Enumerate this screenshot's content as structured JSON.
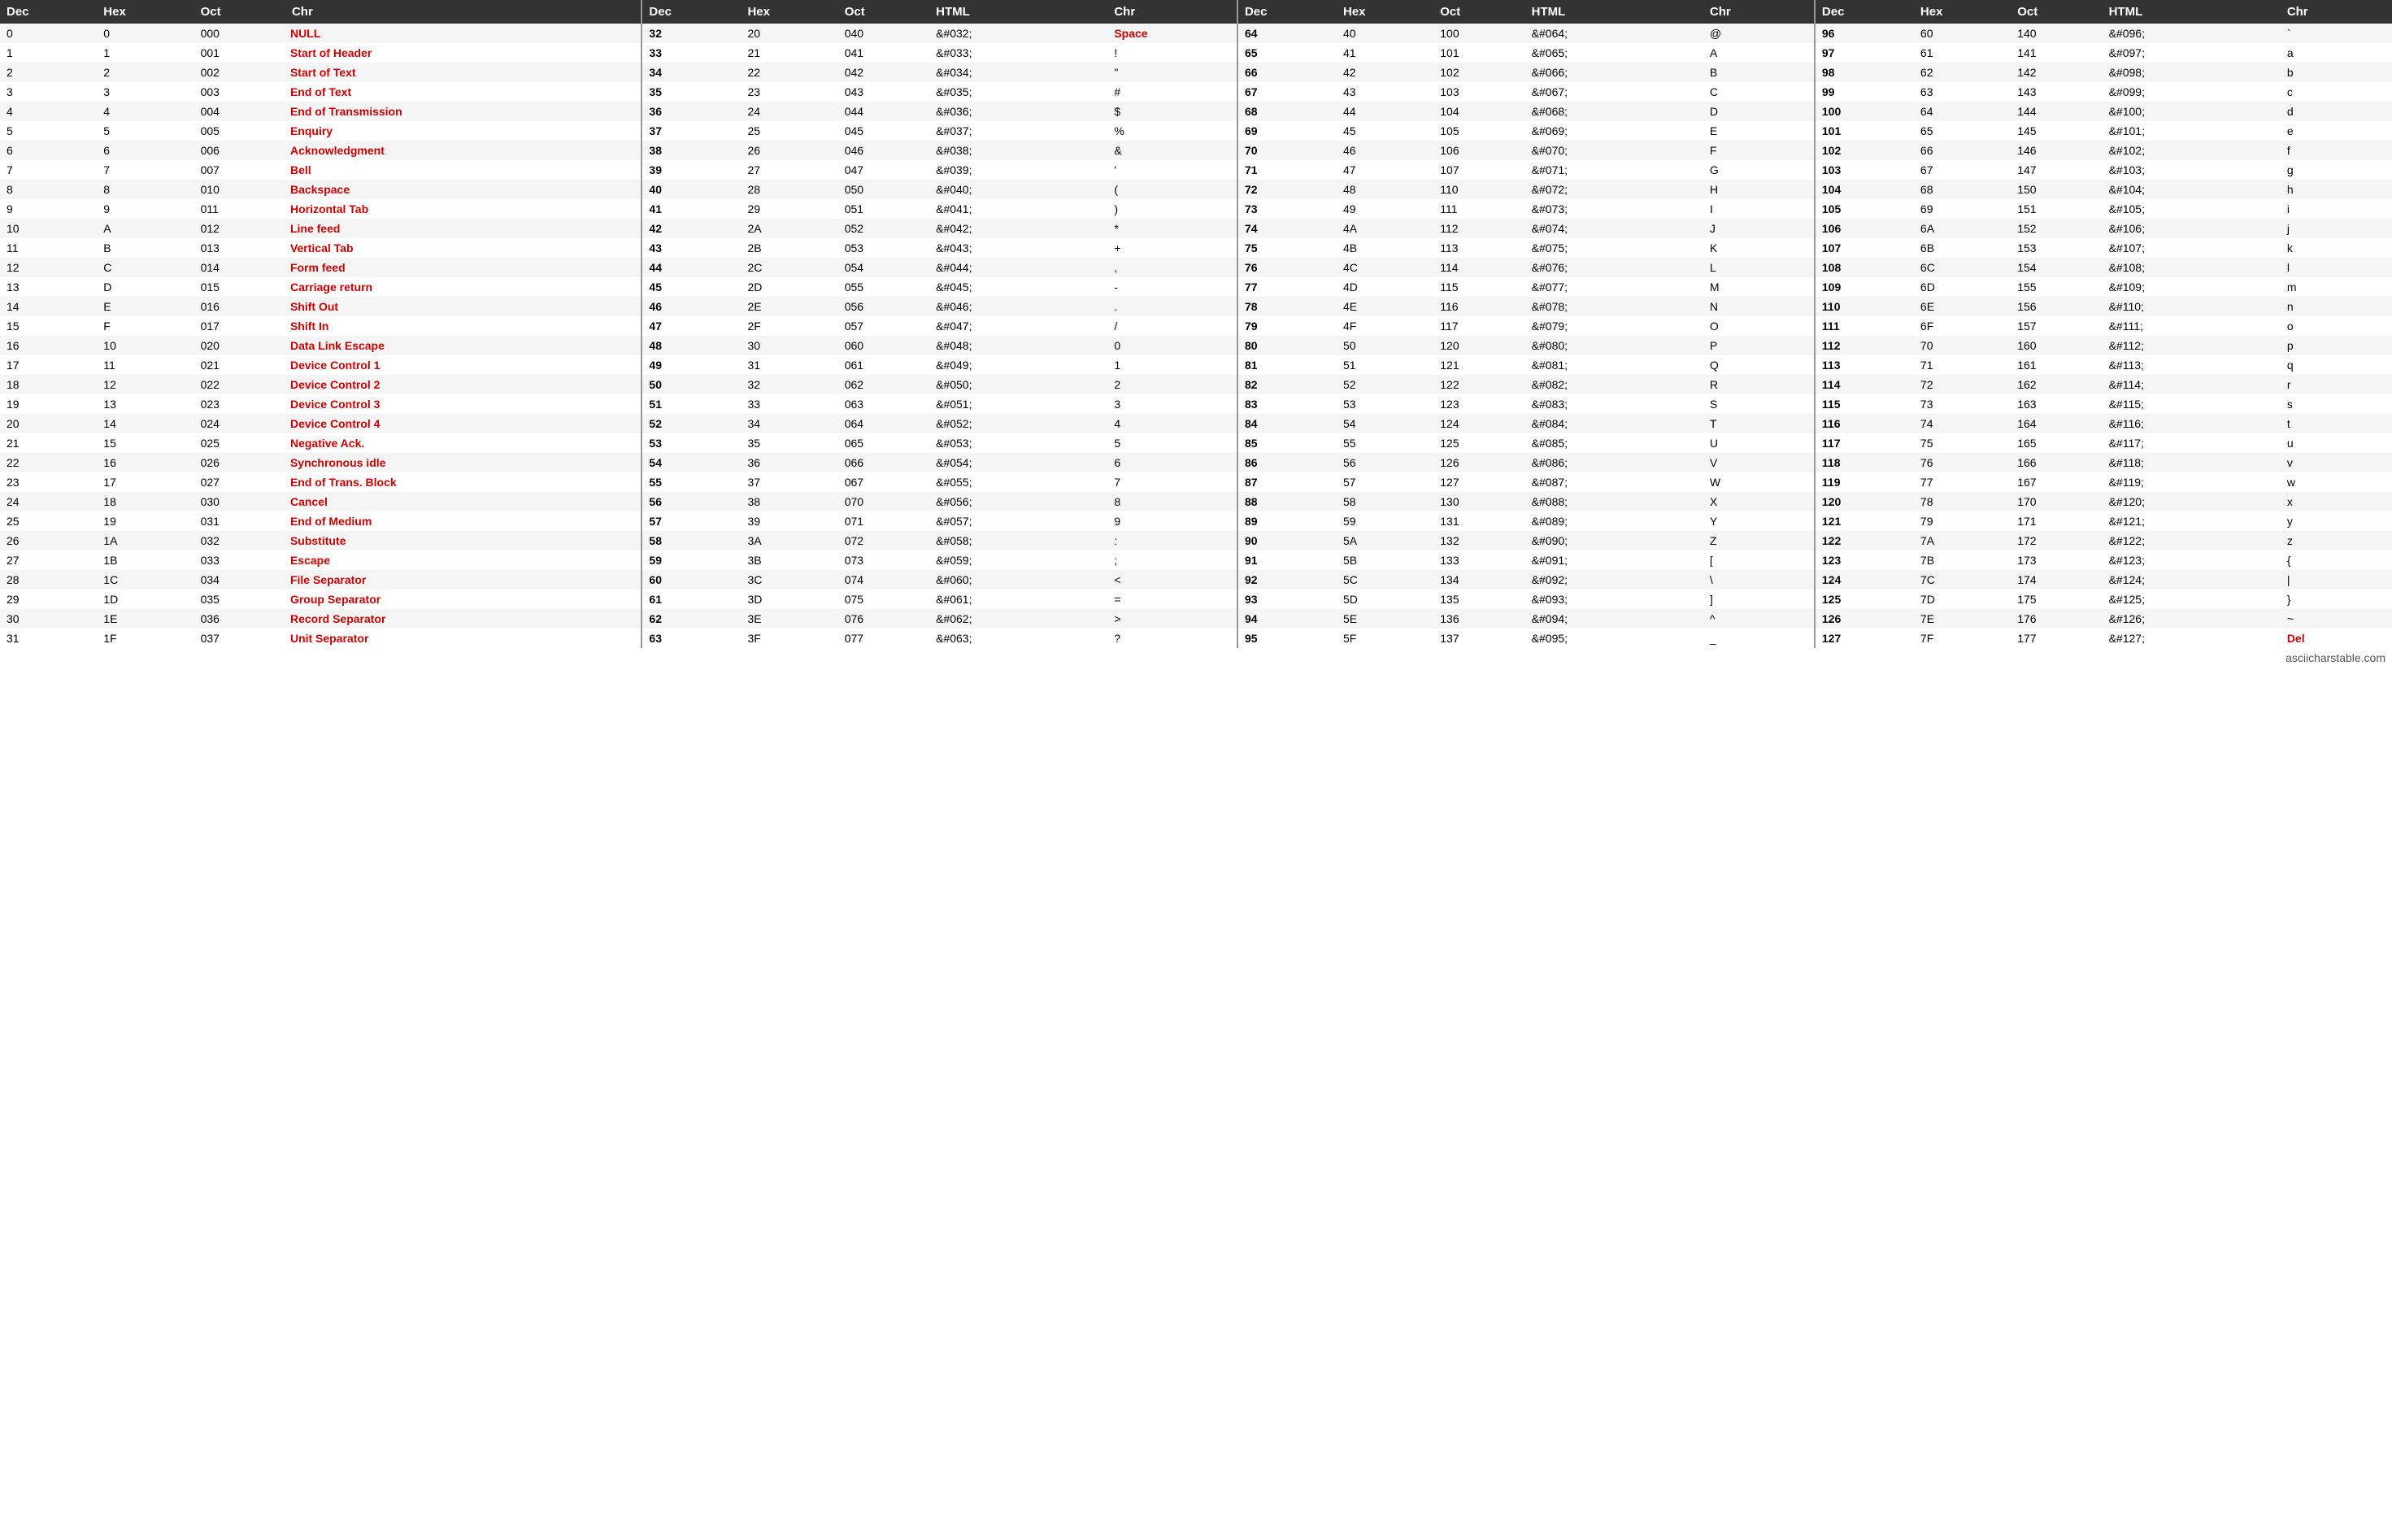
{
  "table": {
    "headers": [
      "Dec",
      "Hex",
      "Oct",
      "Chr",
      "Dec",
      "Hex",
      "Oct",
      "HTML",
      "Chr",
      "Dec",
      "Hex",
      "Oct",
      "HTML",
      "Chr",
      "Dec",
      "Hex",
      "Oct",
      "HTML",
      "Chr"
    ],
    "rows": [
      [
        0,
        "0",
        "000",
        "NULL",
        32,
        "20",
        "040",
        "&#032;",
        "Space",
        64,
        "40",
        "100",
        "&#064;",
        "@",
        96,
        "60",
        "140",
        "&#096;",
        "`"
      ],
      [
        1,
        "1",
        "001",
        "Start of Header",
        33,
        "21",
        "041",
        "&#033;",
        "!",
        65,
        "41",
        "101",
        "&#065;",
        "A",
        97,
        "61",
        "141",
        "&#097;",
        "a"
      ],
      [
        2,
        "2",
        "002",
        "Start of Text",
        34,
        "22",
        "042",
        "&#034;",
        "\"",
        66,
        "42",
        "102",
        "&#066;",
        "B",
        98,
        "62",
        "142",
        "&#098;",
        "b"
      ],
      [
        3,
        "3",
        "003",
        "End of Text",
        35,
        "23",
        "043",
        "&#035;",
        "#",
        67,
        "43",
        "103",
        "&#067;",
        "C",
        99,
        "63",
        "143",
        "&#099;",
        "c"
      ],
      [
        4,
        "4",
        "004",
        "End of Transmission",
        36,
        "24",
        "044",
        "&#036;",
        "$",
        68,
        "44",
        "104",
        "&#068;",
        "D",
        100,
        "64",
        "144",
        "&#100;",
        "d"
      ],
      [
        5,
        "5",
        "005",
        "Enquiry",
        37,
        "25",
        "045",
        "&#037;",
        "%",
        69,
        "45",
        "105",
        "&#069;",
        "E",
        101,
        "65",
        "145",
        "&#101;",
        "e"
      ],
      [
        6,
        "6",
        "006",
        "Acknowledgment",
        38,
        "26",
        "046",
        "&#038;",
        "&",
        70,
        "46",
        "106",
        "&#070;",
        "F",
        102,
        "66",
        "146",
        "&#102;",
        "f"
      ],
      [
        7,
        "7",
        "007",
        "Bell",
        39,
        "27",
        "047",
        "&#039;",
        "'",
        71,
        "47",
        "107",
        "&#071;",
        "G",
        103,
        "67",
        "147",
        "&#103;",
        "g"
      ],
      [
        8,
        "8",
        "010",
        "Backspace",
        40,
        "28",
        "050",
        "&#040;",
        "(",
        72,
        "48",
        "110",
        "&#072;",
        "H",
        104,
        "68",
        "150",
        "&#104;",
        "h"
      ],
      [
        9,
        "9",
        "011",
        "Horizontal Tab",
        41,
        "29",
        "051",
        "&#041;",
        ")",
        73,
        "49",
        "111",
        "&#073;",
        "I",
        105,
        "69",
        "151",
        "&#105;",
        "i"
      ],
      [
        10,
        "A",
        "012",
        "Line feed",
        42,
        "2A",
        "052",
        "&#042;",
        "*",
        74,
        "4A",
        "112",
        "&#074;",
        "J",
        106,
        "6A",
        "152",
        "&#106;",
        "j"
      ],
      [
        11,
        "B",
        "013",
        "Vertical Tab",
        43,
        "2B",
        "053",
        "&#043;",
        "+",
        75,
        "4B",
        "113",
        "&#075;",
        "K",
        107,
        "6B",
        "153",
        "&#107;",
        "k"
      ],
      [
        12,
        "C",
        "014",
        "Form feed",
        44,
        "2C",
        "054",
        "&#044;",
        ",",
        76,
        "4C",
        "114",
        "&#076;",
        "L",
        108,
        "6C",
        "154",
        "&#108;",
        "l"
      ],
      [
        13,
        "D",
        "015",
        "Carriage return",
        45,
        "2D",
        "055",
        "&#045;",
        "-",
        77,
        "4D",
        "115",
        "&#077;",
        "M",
        109,
        "6D",
        "155",
        "&#109;",
        "m"
      ],
      [
        14,
        "E",
        "016",
        "Shift Out",
        46,
        "2E",
        "056",
        "&#046;",
        ".",
        78,
        "4E",
        "116",
        "&#078;",
        "N",
        110,
        "6E",
        "156",
        "&#110;",
        "n"
      ],
      [
        15,
        "F",
        "017",
        "Shift In",
        47,
        "2F",
        "057",
        "&#047;",
        "/",
        79,
        "4F",
        "117",
        "&#079;",
        "O",
        111,
        "6F",
        "157",
        "&#111;",
        "o"
      ],
      [
        16,
        "10",
        "020",
        "Data Link Escape",
        48,
        "30",
        "060",
        "&#048;",
        "0",
        80,
        "50",
        "120",
        "&#080;",
        "P",
        112,
        "70",
        "160",
        "&#112;",
        "p"
      ],
      [
        17,
        "11",
        "021",
        "Device Control 1",
        49,
        "31",
        "061",
        "&#049;",
        "1",
        81,
        "51",
        "121",
        "&#081;",
        "Q",
        113,
        "71",
        "161",
        "&#113;",
        "q"
      ],
      [
        18,
        "12",
        "022",
        "Device Control 2",
        50,
        "32",
        "062",
        "&#050;",
        "2",
        82,
        "52",
        "122",
        "&#082;",
        "R",
        114,
        "72",
        "162",
        "&#114;",
        "r"
      ],
      [
        19,
        "13",
        "023",
        "Device Control 3",
        51,
        "33",
        "063",
        "&#051;",
        "3",
        83,
        "53",
        "123",
        "&#083;",
        "S",
        115,
        "73",
        "163",
        "&#115;",
        "s"
      ],
      [
        20,
        "14",
        "024",
        "Device Control 4",
        52,
        "34",
        "064",
        "&#052;",
        "4",
        84,
        "54",
        "124",
        "&#084;",
        "T",
        116,
        "74",
        "164",
        "&#116;",
        "t"
      ],
      [
        21,
        "15",
        "025",
        "Negative Ack.",
        53,
        "35",
        "065",
        "&#053;",
        "5",
        85,
        "55",
        "125",
        "&#085;",
        "U",
        117,
        "75",
        "165",
        "&#117;",
        "u"
      ],
      [
        22,
        "16",
        "026",
        "Synchronous idle",
        54,
        "36",
        "066",
        "&#054;",
        "6",
        86,
        "56",
        "126",
        "&#086;",
        "V",
        118,
        "76",
        "166",
        "&#118;",
        "v"
      ],
      [
        23,
        "17",
        "027",
        "End of Trans. Block",
        55,
        "37",
        "067",
        "&#055;",
        "7",
        87,
        "57",
        "127",
        "&#087;",
        "W",
        119,
        "77",
        "167",
        "&#119;",
        "w"
      ],
      [
        24,
        "18",
        "030",
        "Cancel",
        56,
        "38",
        "070",
        "&#056;",
        "8",
        88,
        "58",
        "130",
        "&#088;",
        "X",
        120,
        "78",
        "170",
        "&#120;",
        "x"
      ],
      [
        25,
        "19",
        "031",
        "End of Medium",
        57,
        "39",
        "071",
        "&#057;",
        "9",
        89,
        "59",
        "131",
        "&#089;",
        "Y",
        121,
        "79",
        "171",
        "&#121;",
        "y"
      ],
      [
        26,
        "1A",
        "032",
        "Substitute",
        58,
        "3A",
        "072",
        "&#058;",
        ":",
        90,
        "5A",
        "132",
        "&#090;",
        "Z",
        122,
        "7A",
        "172",
        "&#122;",
        "z"
      ],
      [
        27,
        "1B",
        "033",
        "Escape",
        59,
        "3B",
        "073",
        "&#059;",
        ";",
        91,
        "5B",
        "133",
        "&#091;",
        "[",
        123,
        "7B",
        "173",
        "&#123;",
        "{"
      ],
      [
        28,
        "1C",
        "034",
        "File Separator",
        60,
        "3C",
        "074",
        "&#060;",
        "<",
        92,
        "5C",
        "134",
        "&#092;",
        "\\",
        124,
        "7C",
        "174",
        "&#124;",
        "|"
      ],
      [
        29,
        "1D",
        "035",
        "Group Separator",
        61,
        "3D",
        "075",
        "&#061;",
        "=",
        93,
        "5D",
        "135",
        "&#093;",
        "]",
        125,
        "7D",
        "175",
        "&#125;",
        "}"
      ],
      [
        30,
        "1E",
        "036",
        "Record Separator",
        62,
        "3E",
        "076",
        "&#062;",
        ">",
        94,
        "5E",
        "136",
        "&#094;",
        "^",
        126,
        "7E",
        "176",
        "&#126;",
        "~"
      ],
      [
        31,
        "1F",
        "037",
        "Unit Separator",
        63,
        "3F",
        "077",
        "&#063;",
        "?",
        95,
        "5F",
        "137",
        "&#095;",
        "_",
        127,
        "7F",
        "177",
        "&#127;",
        "Del"
      ]
    ],
    "footer": "asciicharstable.com"
  }
}
